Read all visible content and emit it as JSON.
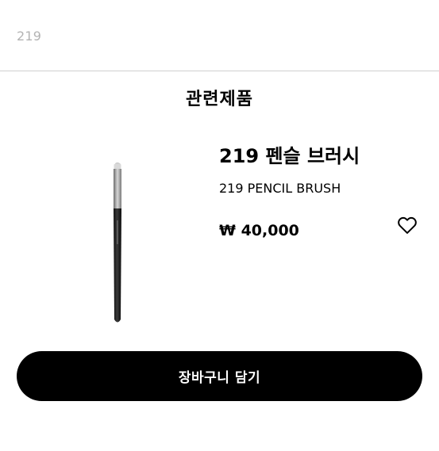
{
  "header": {
    "label": "219"
  },
  "section": {
    "title": "관련제품"
  },
  "product": {
    "name_ko": "219 펜슬 브러시",
    "name_en": "219 PENCIL BRUSH",
    "price": "₩ 40,000",
    "wishlist_icon": "heart-outline-icon",
    "image_icon": "pencil-brush-image"
  },
  "actions": {
    "add_to_cart_label": "장바구니 담기"
  },
  "colors": {
    "accent": "#000000",
    "muted_text": "#b3b3b3",
    "divider": "#cfcfcf",
    "background": "#ffffff"
  }
}
